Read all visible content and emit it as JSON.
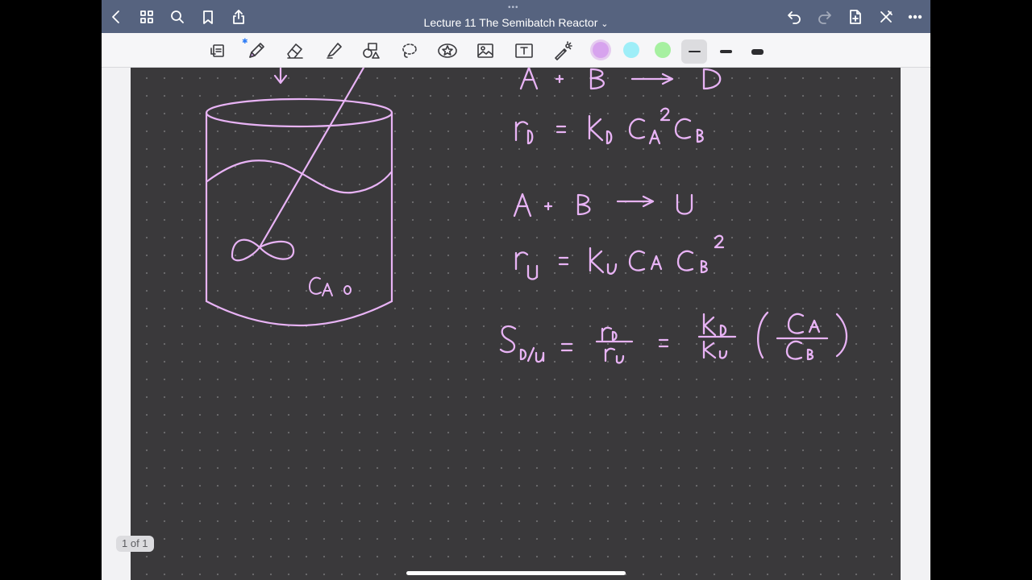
{
  "app": {
    "title": "Lecture 11 The Semibatch Reactor",
    "title_chevron": "⌄",
    "grabber": "•••"
  },
  "titlebar_left": [
    {
      "name": "back-button",
      "icon": "chevron-left-icon"
    },
    {
      "name": "thumbnails-button",
      "icon": "grid-icon"
    },
    {
      "name": "search-button",
      "icon": "search-icon"
    },
    {
      "name": "bookmark-button",
      "icon": "bookmark-icon"
    },
    {
      "name": "share-button",
      "icon": "share-icon"
    }
  ],
  "titlebar_right": [
    {
      "name": "undo-button",
      "icon": "undo-icon"
    },
    {
      "name": "redo-button",
      "icon": "redo-icon"
    },
    {
      "name": "add-page-button",
      "icon": "add-page-icon"
    },
    {
      "name": "close-toolbar-button",
      "icon": "no-edit-icon"
    },
    {
      "name": "more-button",
      "icon": "ellipsis-icon"
    }
  ],
  "toolbar": {
    "tools": [
      "lasso-ocr-icon",
      "pen-icon",
      "eraser-icon",
      "highlighter-icon",
      "shapes-icon",
      "lasso-icon",
      "sticker-icon",
      "image-icon",
      "text-icon",
      "laser-pointer-icon"
    ],
    "selected_tool": "pen-icon",
    "colors": {
      "selected": "#d7a3ee",
      "options": [
        "#d7a3ee",
        "#9eeef8",
        "#a6f0a0"
      ]
    },
    "stroke_widths": [
      "thin",
      "medium",
      "thick"
    ],
    "selected_stroke": "thin"
  },
  "page": {
    "indicator": "1 of 1",
    "background": "#3a393b",
    "ink_color": "#e8b3f5"
  },
  "handwriting": {
    "reaction_1": "A + B → D",
    "rate_1": "rD = kD CA² CB",
    "reaction_2": "A + B → U",
    "rate_2": "rU = kU CA CB²",
    "selectivity": "SD/U = rD / rU = kD / kU (CA / CB)",
    "tank_label": "CA0"
  }
}
